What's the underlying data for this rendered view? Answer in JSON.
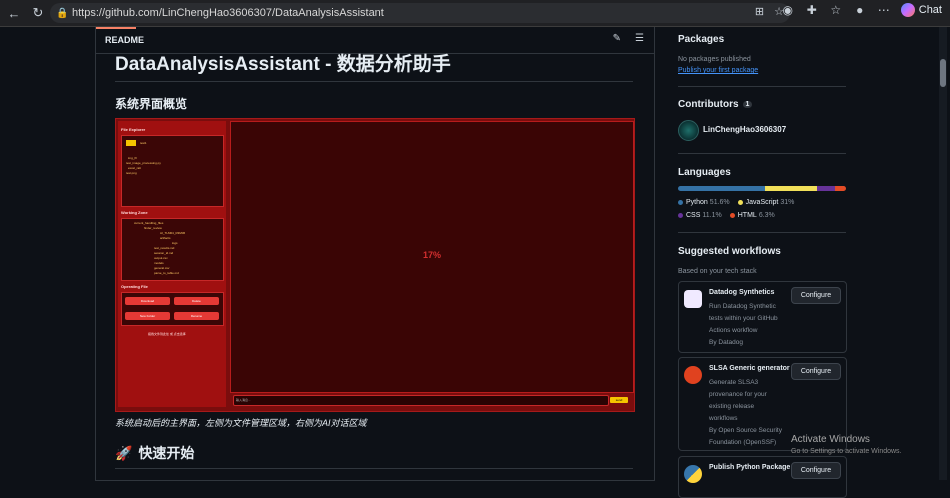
{
  "browser": {
    "url": "https://github.com/LinChengHao3606307/DataAnalysisAssistant",
    "chat_label": "Chat"
  },
  "readme": {
    "tab_label": "README",
    "title": "DataAnalysisAssistant - 数据分析助手",
    "section1": "系统界面概览",
    "caption": "系统启动后的主界面，左侧为文件管理区域，右侧为AI对话区域",
    "section2": "快速开始",
    "section2_emoji": "🚀",
    "screenshot": {
      "file_explorer_title": "File Explorer",
      "working_zone_title": "Working Zone",
      "operating_file_title": "Operating File",
      "folder_name": "test1",
      "file_items": [
        "img_fil",
        "test_image_processing.py",
        "excel_ralt",
        "test.png"
      ],
      "working_items": [
        "current_handling_files",
        "finder_review",
        "AI_TLM04_R3M36",
        "artifacts",
        "logs",
        "test_results.md",
        "session_id.md",
        "output.csv",
        "models",
        "general.csv",
        "parse_to_table.md"
      ],
      "btn_download": "Download",
      "btn_delete": "Delete",
      "btn_new_folder": "New Folder",
      "btn_rename": "Rename",
      "footer_text": "拖拽文件到此处 或 点击选择",
      "progress_text": "17%",
      "input_placeholder": "输入消息...",
      "send_label": "send"
    }
  },
  "sidebar": {
    "packages_title": "Packages",
    "packages_empty": "No packages published",
    "packages_link": "Publish your first package",
    "contributors_title": "Contributors",
    "contributors_count": "1",
    "contributor_name": "LinChengHao3606307",
    "languages_title": "Languages",
    "languages": [
      {
        "name": "Python",
        "percent": "51.6%",
        "value": 51.6,
        "color": "#3572A5"
      },
      {
        "name": "JavaScript",
        "percent": "31%",
        "value": 31.0,
        "color": "#f1e05a"
      },
      {
        "name": "CSS",
        "percent": "11.1%",
        "value": 11.1,
        "color": "#663399"
      },
      {
        "name": "HTML",
        "percent": "6.3%",
        "value": 6.3,
        "color": "#e34c26"
      }
    ],
    "workflows_title": "Suggested workflows",
    "workflows_subtitle": "Based on your tech stack",
    "workflows": [
      {
        "name": "Datadog Synthetics",
        "desc1": "Run Datadog Synthetic",
        "desc2": "tests within your GitHub",
        "desc3": "Actions workflow",
        "desc4": "By Datadog",
        "desc5": "",
        "button": "Configure"
      },
      {
        "name": "SLSA Generic generator",
        "desc1": "Generate SLSA3",
        "desc2": "provenance for your",
        "desc3": "existing release",
        "desc4": "workflows",
        "desc5": "By Open Source Security Foundation (OpenSSF)",
        "button": "Configure"
      },
      {
        "name": "Publish Python Package",
        "desc1": "",
        "desc2": "",
        "desc3": "",
        "desc4": "",
        "desc5": "",
        "button": "Configure"
      }
    ]
  },
  "watermark": {
    "line1": "Activate Windows",
    "line2": "Go to Settings to activate Windows."
  }
}
